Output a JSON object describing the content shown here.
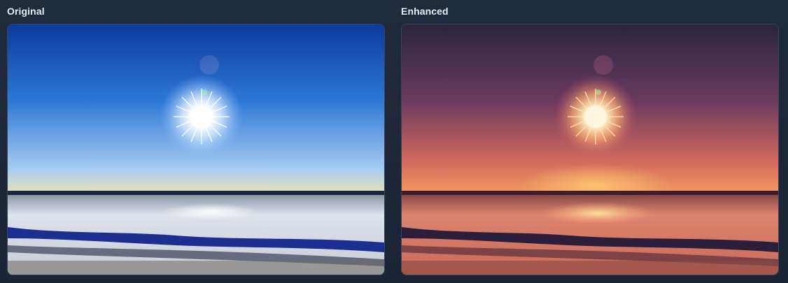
{
  "panels": {
    "original": {
      "title": "Original",
      "image_alt": "sunlit snowy field under clear blue sky",
      "colors": {
        "sky_top": "#0b3a9c",
        "sky_mid": "#2f78d6",
        "sky_horizon": "#bcd6ee",
        "horizon_glow": "#f3e6b4",
        "snow": "#d9dde6",
        "shadow": "#1a2f8a"
      }
    },
    "enhanced": {
      "title": "Enhanced",
      "image_alt": "sunlit snowy field with warm sunset tones",
      "colors": {
        "sky_top": "#2a2540",
        "sky_mid": "#6b3a5e",
        "sky_horizon": "#f08060",
        "horizon_glow": "#ffd070",
        "snow": "#d9806a",
        "shadow": "#2a1e3a"
      }
    }
  }
}
